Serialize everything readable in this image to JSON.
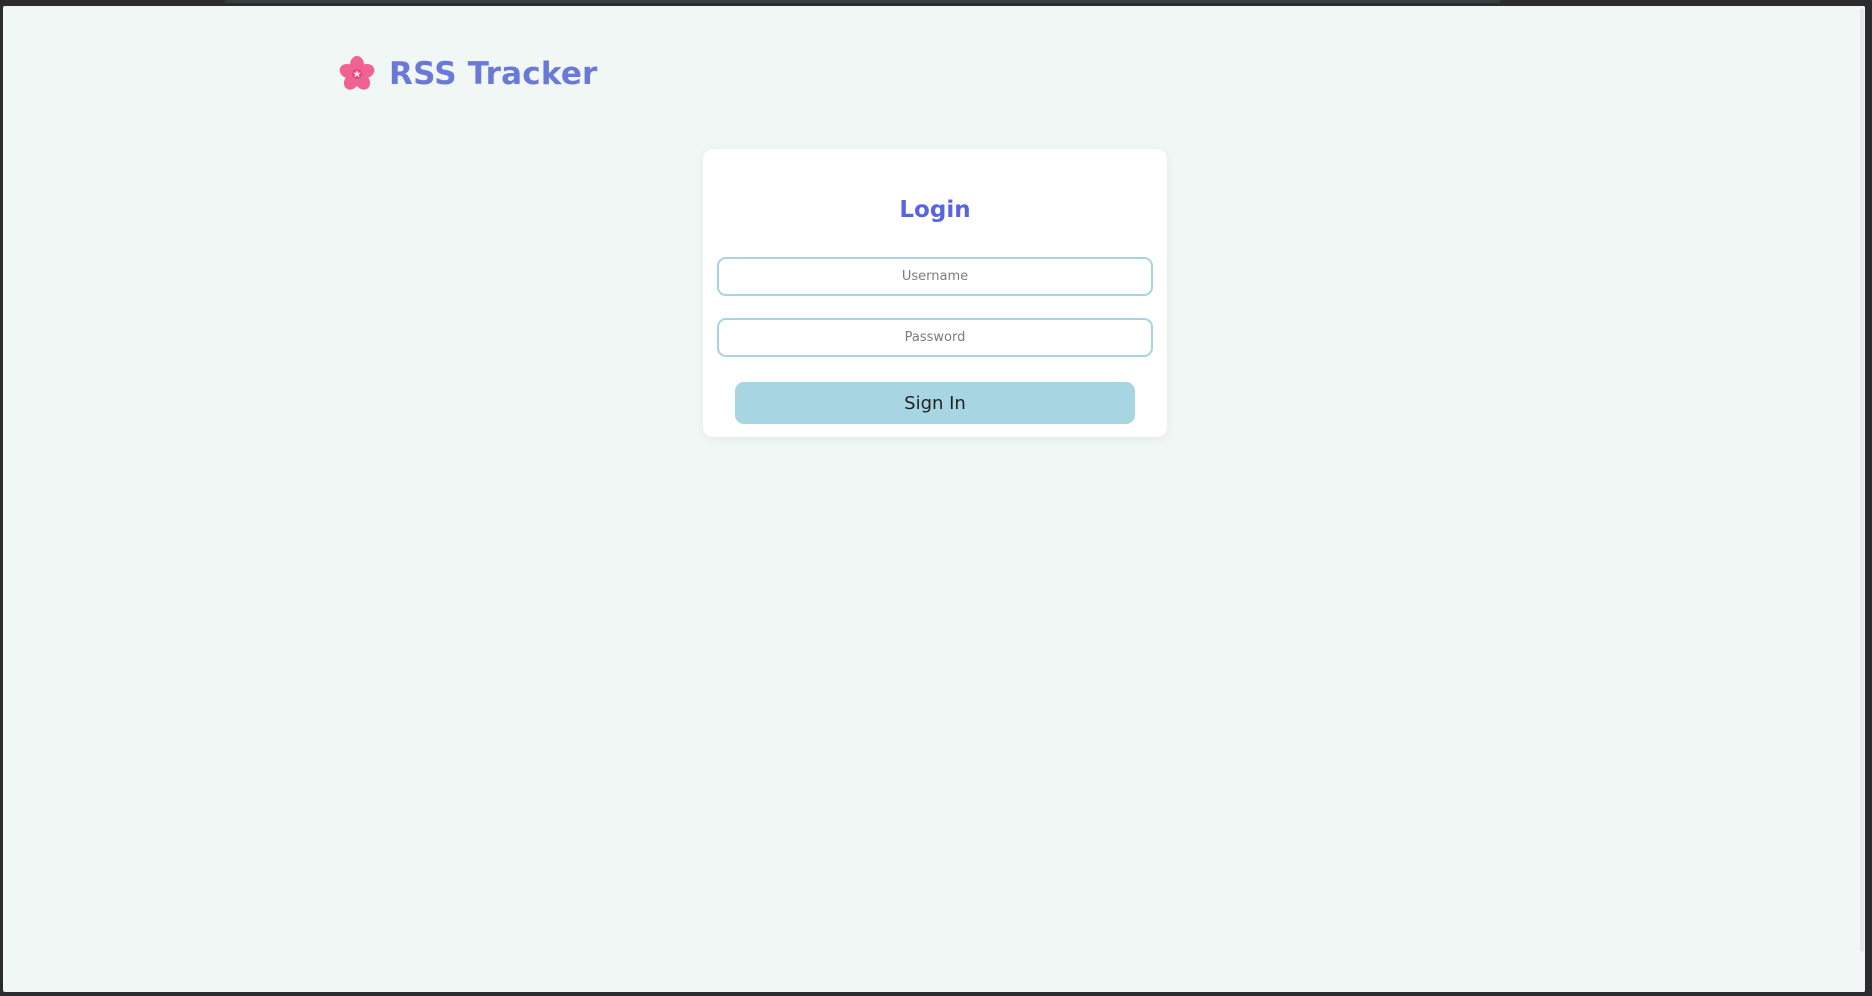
{
  "app": {
    "brand_title": "RSS Tracker",
    "logo_icon": "cherry-blossom-icon"
  },
  "login": {
    "title": "Login",
    "username_placeholder": "Username",
    "password_placeholder": "Password",
    "signin_label": "Sign In"
  },
  "colors": {
    "background": "#f0f7f4",
    "brand": "#6a78d6",
    "title": "#5965dd",
    "input_border": "#a8d3e2",
    "button": "#a8d5e2",
    "logo": "#f06292"
  }
}
